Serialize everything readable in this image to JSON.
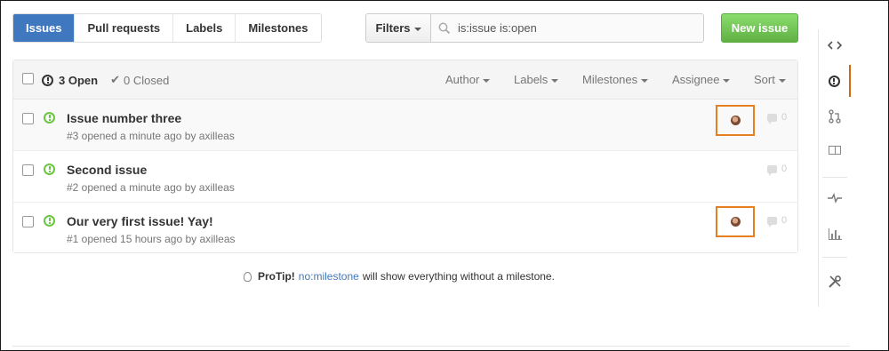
{
  "subnav": {
    "items": [
      {
        "label": "Issues",
        "active": true
      },
      {
        "label": "Pull requests",
        "active": false
      },
      {
        "label": "Labels",
        "active": false
      },
      {
        "label": "Milestones",
        "active": false
      }
    ]
  },
  "filters": {
    "button_label": "Filters",
    "search_value": "is:issue is:open"
  },
  "new_issue_label": "New issue",
  "header": {
    "open_label": "3 Open",
    "closed_label": "0 Closed",
    "menus": [
      "Author",
      "Labels",
      "Milestones",
      "Assignee",
      "Sort"
    ]
  },
  "issues": [
    {
      "title": "Issue number three",
      "meta": "#3 opened a minute ago by",
      "author": "axilleas",
      "has_assignee": true,
      "comments": "0"
    },
    {
      "title": "Second issue",
      "meta": "#2 opened a minute ago by",
      "author": "axilleas",
      "has_assignee": false,
      "comments": "0"
    },
    {
      "title": "Our very first issue! Yay!",
      "meta": "#1 opened 15 hours ago by",
      "author": "axilleas",
      "has_assignee": true,
      "comments": "0"
    }
  ],
  "protip": {
    "label": "ProTip!",
    "link": "no:milestone",
    "text": "will show everything without a milestone."
  },
  "colors": {
    "accent_blue": "#4078c0",
    "new_issue_green": "#6cc644",
    "highlight_orange": "#e67e22"
  },
  "side_nav_icons": [
    "code-icon",
    "issues-icon",
    "pull-request-icon",
    "wiki-icon",
    "pulse-icon",
    "graphs-icon",
    "settings-icon"
  ]
}
